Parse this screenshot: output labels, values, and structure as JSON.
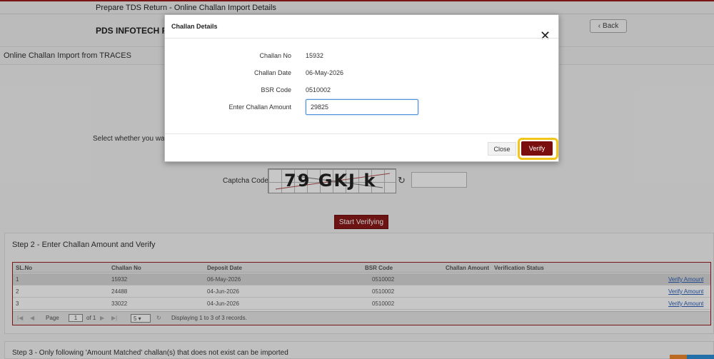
{
  "breadcrumb": "Prepare TDS Return - Online Challan Import Details",
  "header": {
    "company": "PDS INFOTECH PVT.",
    "back_label": "Back"
  },
  "section_title": "Online Challan Import from TRACES",
  "select_prompt": "Select whether you want",
  "captcha": {
    "label": "Captcha Code",
    "text": "79 GKJ k",
    "input_value": ""
  },
  "start_button": "Start Verifying",
  "step2": {
    "title": "Step 2 - Enter Challan Amount and Verify",
    "columns": [
      "SL.No",
      "Challan No",
      "Deposit Date",
      "BSR Code",
      "Challan Amount",
      "Verification Status"
    ],
    "rows": [
      {
        "sl": "1",
        "challan_no": "15932",
        "deposit_date": "06-May-2026",
        "bsr": "0510002",
        "amount": "",
        "status": "",
        "action": "Verify Amount"
      },
      {
        "sl": "2",
        "challan_no": "24488",
        "deposit_date": "04-Jun-2026",
        "bsr": "0510002",
        "amount": "",
        "status": "",
        "action": "Verify Amount"
      },
      {
        "sl": "3",
        "challan_no": "33022",
        "deposit_date": "04-Jun-2026",
        "bsr": "0510002",
        "amount": "",
        "status": "",
        "action": "Verify Amount"
      }
    ],
    "pager": {
      "page_label": "Page",
      "page": "1",
      "of_label": "of 1",
      "page_size": "5",
      "summary": "Displaying 1 to 3 of 3 records."
    }
  },
  "step3_title": "Step 3 - Only following 'Amount Matched' challan(s) that does not exist can be imported",
  "modal": {
    "title": "Challan Details",
    "fields": [
      {
        "label": "Challan No",
        "value": "15932"
      },
      {
        "label": "Challan Date",
        "value": "06-May-2026"
      },
      {
        "label": "BSR Code",
        "value": "0510002"
      }
    ],
    "amount_label": "Enter Challan Amount",
    "amount_value": "29825",
    "close_label": "Close",
    "verify_label": "Verify"
  },
  "icons": {
    "close": "close-icon",
    "refresh": "refresh-icon",
    "back": "chevron-left-icon"
  },
  "colors": {
    "accent": "#8b1a1a",
    "highlight": "#f2c51a",
    "link": "#2b5fb8"
  }
}
